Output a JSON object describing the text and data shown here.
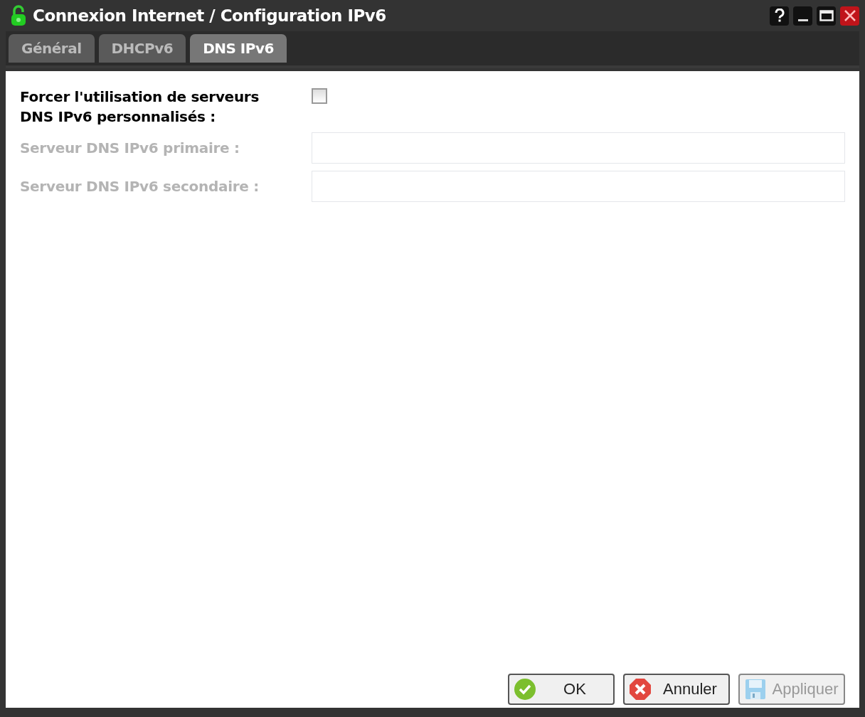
{
  "window": {
    "title": "Connexion Internet / Configuration IPv6"
  },
  "tabs": [
    {
      "label": "Général",
      "selected": false
    },
    {
      "label": "DHCPv6",
      "selected": false
    },
    {
      "label": "DNS IPv6",
      "selected": true
    }
  ],
  "form": [
    {
      "kind": "checkbox",
      "label": "Forcer l'utilisation de serveurs DNS IPv6 personnalisés :",
      "checked": false
    },
    {
      "kind": "text",
      "label": "Serveur DNS IPv6 primaire :",
      "disabled": true
    },
    {
      "kind": "text",
      "label": "Serveur DNS IPv6 secondaire :",
      "disabled": true
    }
  ],
  "buttons": [
    {
      "label": "OK",
      "kind": "ok",
      "disabled": false
    },
    {
      "label": "Annuler",
      "kind": "cancel",
      "disabled": false
    },
    {
      "label": "Appliquer",
      "kind": "apply",
      "disabled": true
    }
  ]
}
